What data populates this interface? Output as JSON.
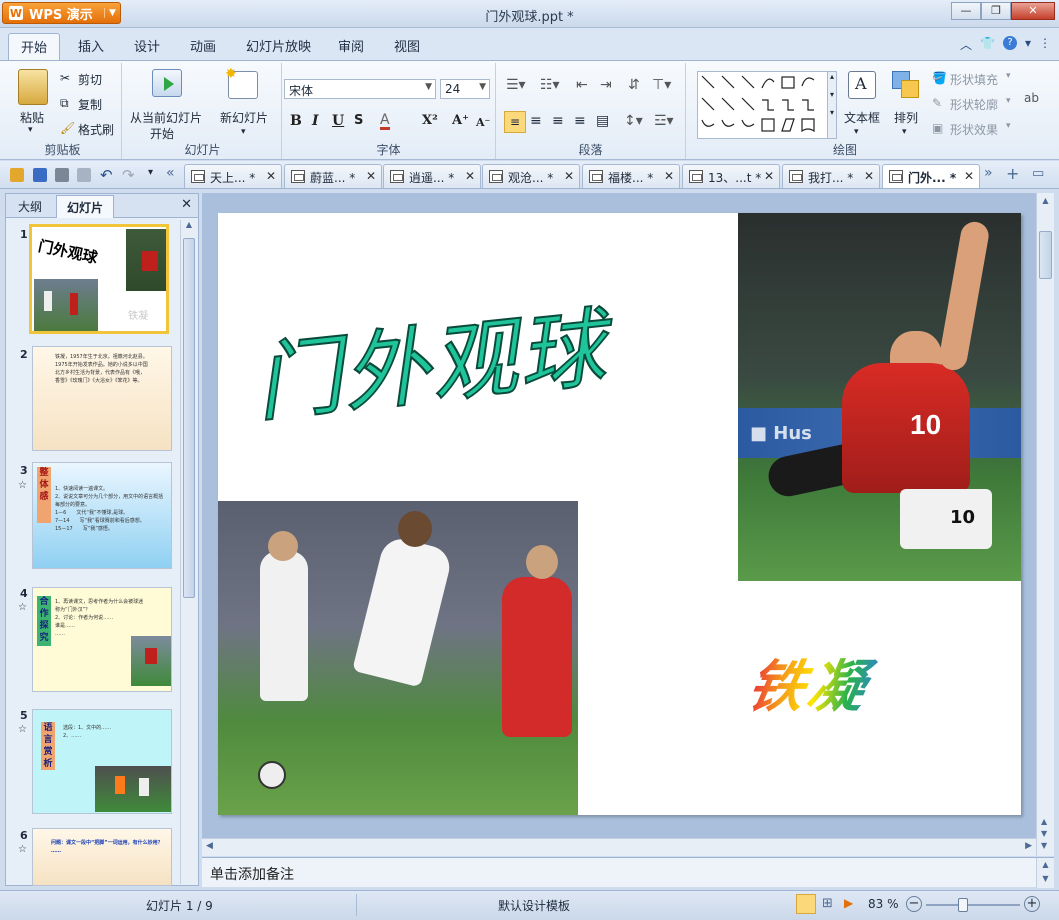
{
  "app": {
    "button_label": "WPS 演示",
    "doc_title": "门外观球.ppt *"
  },
  "menu": {
    "tabs": [
      "开始",
      "插入",
      "设计",
      "动画",
      "幻灯片放映",
      "审阅",
      "视图"
    ]
  },
  "ribbon": {
    "clipboard": {
      "label": "剪贴板",
      "paste": "粘贴",
      "cut": "剪切",
      "copy": "复制",
      "format_painter": "格式刷"
    },
    "slides": {
      "label": "幻灯片",
      "from_current_1": "从当前幻灯片",
      "from_current_2": "开始",
      "new_slide": "新幻灯片"
    },
    "font": {
      "label": "字体",
      "font_name": "宋体",
      "font_size": "24"
    },
    "paragraph": {
      "label": "段落"
    },
    "drawing": {
      "label": "绘图",
      "textbox": "文本框",
      "arrange": "排列",
      "shape_fill": "形状填充",
      "shape_outline": "形状轮廓",
      "shape_effect": "形状效果"
    }
  },
  "doc_tabs": [
    "天上... *",
    "蔚蓝... *",
    "逍遥... *",
    "观沧... *",
    "福楼... *",
    "13、...t *",
    "我打... *",
    "门外... *"
  ],
  "left_panel": {
    "tabs": [
      "大纲",
      "幻灯片"
    ],
    "thumbnails": [
      {
        "num": "1"
      },
      {
        "num": "2",
        "text": "铁凝，1957年生于北京。祖籍河北赵县。1975年开始发表作品。她的小说多以中国北方乡村生活为背景，代表作品有《哦，香雪》《玫瑰门》《大浴女》《笨花》等。"
      },
      {
        "num": "3",
        "star": "☆",
        "tag": "整体感",
        "lines": [
          "1、快速阅读一遍课文。",
          "2、说说文章可分为几个部分，用文中的语言概括每部分的要意。",
          "1—6　　文代“我”不懂球,是球。",
          "7—14　　写“我”看球赛前和看后感想。",
          "15—17　　写“我”感悟。"
        ]
      },
      {
        "num": "4",
        "star": "☆",
        "tag": "合作探究",
        "lines": [
          "1、再读课文，思考作者为什么会被球迷称为“门外汉”？",
          "2、讨论：作者为何说……",
          "谁是……",
          "……"
        ]
      },
      {
        "num": "5",
        "star": "☆",
        "tag": "语言赏析",
        "lines": [
          "选段：1、文中的……",
          "2、……"
        ]
      },
      {
        "num": "6",
        "star": "☆",
        "lines": [
          "问题：课文一段中“把脚”一词运用，有什么妙用？",
          "……"
        ]
      }
    ]
  },
  "slide": {
    "title": "门外观球",
    "author": "铁凝"
  },
  "notes_placeholder": "单击添加备注",
  "status": {
    "slide_counter": "幻灯片 1 / 9",
    "template": "默认设计模板",
    "zoom": "83 %"
  }
}
